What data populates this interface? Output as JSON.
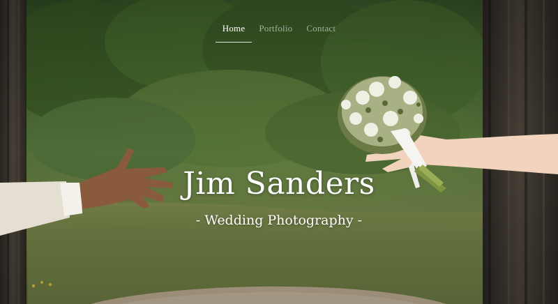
{
  "nav": {
    "items": [
      {
        "label": "Home",
        "active": true
      },
      {
        "label": "Portfolio",
        "active": false
      },
      {
        "label": "Contact",
        "active": false
      }
    ]
  },
  "hero": {
    "title": "Jim Sanders",
    "subtitle": "- Wedding Photography -"
  },
  "colors": {
    "text": "#ffffff",
    "nav_inactive": "#b9bdb0",
    "foliage": "#3d5a2a",
    "path": "#bfae93"
  }
}
